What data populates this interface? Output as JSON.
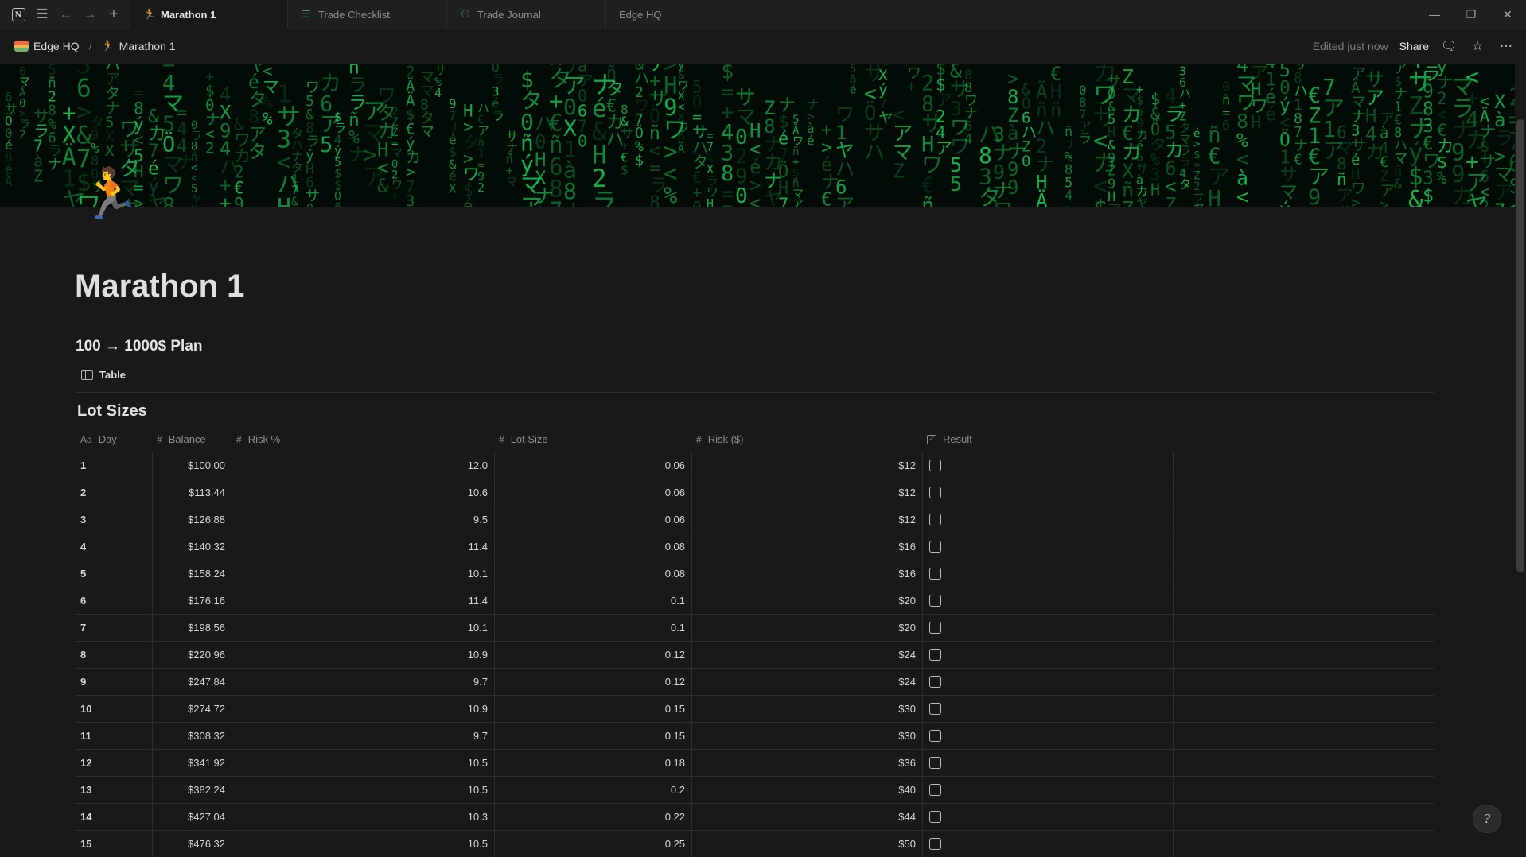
{
  "tabs": [
    {
      "label": "Marathon 1",
      "icon": "runner-icon",
      "active": true
    },
    {
      "label": "Trade Checklist",
      "icon": "checklist-icon",
      "active": false
    },
    {
      "label": "Trade Journal",
      "icon": "people-icon",
      "active": false
    },
    {
      "label": "Edge HQ",
      "icon": "",
      "active": false
    }
  ],
  "breadcrumb": {
    "workspace": "Edge HQ",
    "separator": "/",
    "page": "Marathon 1"
  },
  "topbar": {
    "edited": "Edited just now",
    "share": "Share"
  },
  "page": {
    "icon": "🏃",
    "title": "Marathon 1",
    "subheading": "100 → 1000$ Plan",
    "view_label": "Table",
    "db_title": "Lot Sizes"
  },
  "table": {
    "columns": [
      {
        "icon": "Aa",
        "label": "Day"
      },
      {
        "icon": "#",
        "label": "Balance"
      },
      {
        "icon": "#",
        "label": "Risk %"
      },
      {
        "icon": "#",
        "label": "Lot Size"
      },
      {
        "icon": "#",
        "label": "Risk ($)"
      },
      {
        "icon": "checkbox",
        "label": "Result"
      }
    ],
    "rows": [
      {
        "day": "1",
        "balance": "$100.00",
        "risk_pct": "12.0",
        "lot": "0.06",
        "risk_usd": "$12",
        "result": false
      },
      {
        "day": "2",
        "balance": "$113.44",
        "risk_pct": "10.6",
        "lot": "0.06",
        "risk_usd": "$12",
        "result": false
      },
      {
        "day": "3",
        "balance": "$126.88",
        "risk_pct": "9.5",
        "lot": "0.06",
        "risk_usd": "$12",
        "result": false
      },
      {
        "day": "4",
        "balance": "$140.32",
        "risk_pct": "11.4",
        "lot": "0.08",
        "risk_usd": "$16",
        "result": false
      },
      {
        "day": "5",
        "balance": "$158.24",
        "risk_pct": "10.1",
        "lot": "0.08",
        "risk_usd": "$16",
        "result": false
      },
      {
        "day": "6",
        "balance": "$176.16",
        "risk_pct": "11.4",
        "lot": "0.1",
        "risk_usd": "$20",
        "result": false
      },
      {
        "day": "7",
        "balance": "$198.56",
        "risk_pct": "10.1",
        "lot": "0.1",
        "risk_usd": "$20",
        "result": false
      },
      {
        "day": "8",
        "balance": "$220.96",
        "risk_pct": "10.9",
        "lot": "0.12",
        "risk_usd": "$24",
        "result": false
      },
      {
        "day": "9",
        "balance": "$247.84",
        "risk_pct": "9.7",
        "lot": "0.12",
        "risk_usd": "$24",
        "result": false
      },
      {
        "day": "10",
        "balance": "$274.72",
        "risk_pct": "10.9",
        "lot": "0.15",
        "risk_usd": "$30",
        "result": false
      },
      {
        "day": "11",
        "balance": "$308.32",
        "risk_pct": "9.7",
        "lot": "0.15",
        "risk_usd": "$30",
        "result": false
      },
      {
        "day": "12",
        "balance": "$341.92",
        "risk_pct": "10.5",
        "lot": "0.18",
        "risk_usd": "$36",
        "result": false
      },
      {
        "day": "13",
        "balance": "$382.24",
        "risk_pct": "10.5",
        "lot": "0.2",
        "risk_usd": "$40",
        "result": false
      },
      {
        "day": "14",
        "balance": "$427.04",
        "risk_pct": "10.3",
        "lot": "0.22",
        "risk_usd": "$44",
        "result": false
      },
      {
        "day": "15",
        "balance": "$476.32",
        "risk_pct": "10.5",
        "lot": "0.25",
        "risk_usd": "$50",
        "result": false
      }
    ]
  },
  "cover": {
    "style": "green matrix code rain",
    "accent": "#18c95a"
  },
  "colors": {
    "background": "#191919",
    "titlebar": "#1f1f1f",
    "text": "#d6d6d6",
    "muted": "#8e8e8e",
    "divider": "#2f2f2f"
  }
}
